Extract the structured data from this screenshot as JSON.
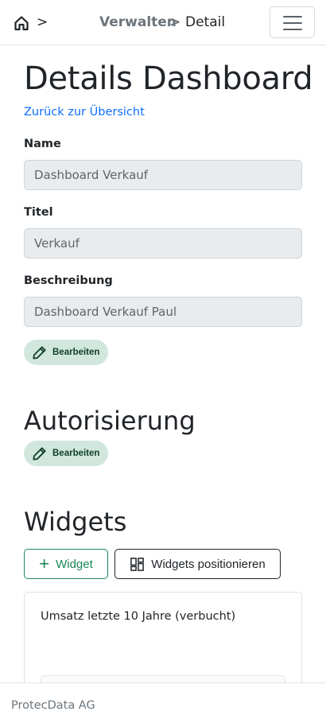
{
  "nav": {
    "separator": ">",
    "breadcrumb_parent": "Verwalten",
    "breadcrumb_separator": ">",
    "breadcrumb_current": "Detail"
  },
  "page": {
    "title": "Details Dashboard",
    "back_link": "Zurück zur Übersicht"
  },
  "fields": [
    {
      "label": "Name",
      "value": "Dashboard Verkauf"
    },
    {
      "label": "Titel",
      "value": "Verkauf"
    },
    {
      "label": "Beschreibung",
      "value": "Dashboard Verkauf Paul"
    }
  ],
  "details_edit_label": "Bearbeiten",
  "authorization": {
    "title": "Autorisierung",
    "edit_label": "Bearbeiten"
  },
  "widgets": {
    "title": "Widgets",
    "add_label": "Widget",
    "position_label": "Widgets positionieren",
    "cards": [
      {
        "title": "Umsatz letzte 10 Jahre (verbucht)"
      }
    ]
  },
  "footer": {
    "company": "ProtecData AG"
  },
  "colors": {
    "link": "#0d6efd",
    "success": "#198754",
    "edit_bg": "#d1e7dd"
  }
}
